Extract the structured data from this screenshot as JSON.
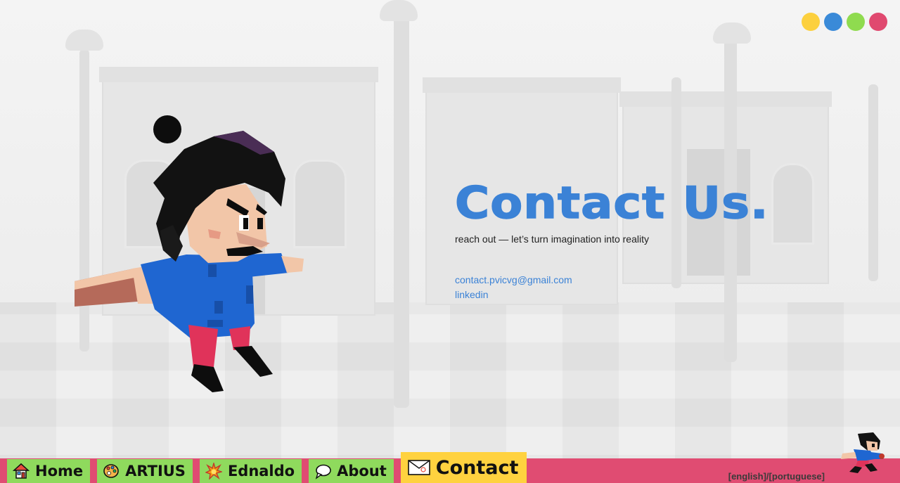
{
  "theme_dots": [
    {
      "name": "yellow-theme-dot",
      "color": "#fcd03e"
    },
    {
      "name": "blue-theme-dot",
      "color": "#3a8ad8"
    },
    {
      "name": "green-theme-dot",
      "color": "#8fdb4f"
    },
    {
      "name": "pink-theme-dot",
      "color": "#e0496f"
    }
  ],
  "contact": {
    "title": "Contact Us.",
    "subtitle": "reach out — let’s turn imagination into reality",
    "email": "contact.pvicvg@gmail.com",
    "linkedin": "linkedin"
  },
  "nav": {
    "home": {
      "label": "Home",
      "icon": "house-icon"
    },
    "artius": {
      "label": "ARTIUS",
      "icon": "palette-icon"
    },
    "ednaldo": {
      "label": "Ednaldo",
      "icon": "explosion-icon"
    },
    "about": {
      "label": "About",
      "icon": "speech-bubble-icon"
    },
    "contact": {
      "label": "Contact",
      "icon": "envelope-icon"
    }
  },
  "language": {
    "english": "[english]",
    "separator": "/",
    "portuguese": "[portuguese]"
  },
  "colors": {
    "accent_blue": "#3b82d6",
    "nav_green": "#8fda5d",
    "nav_active_yellow": "#ffd23f",
    "bar_pink": "#e04c72"
  }
}
